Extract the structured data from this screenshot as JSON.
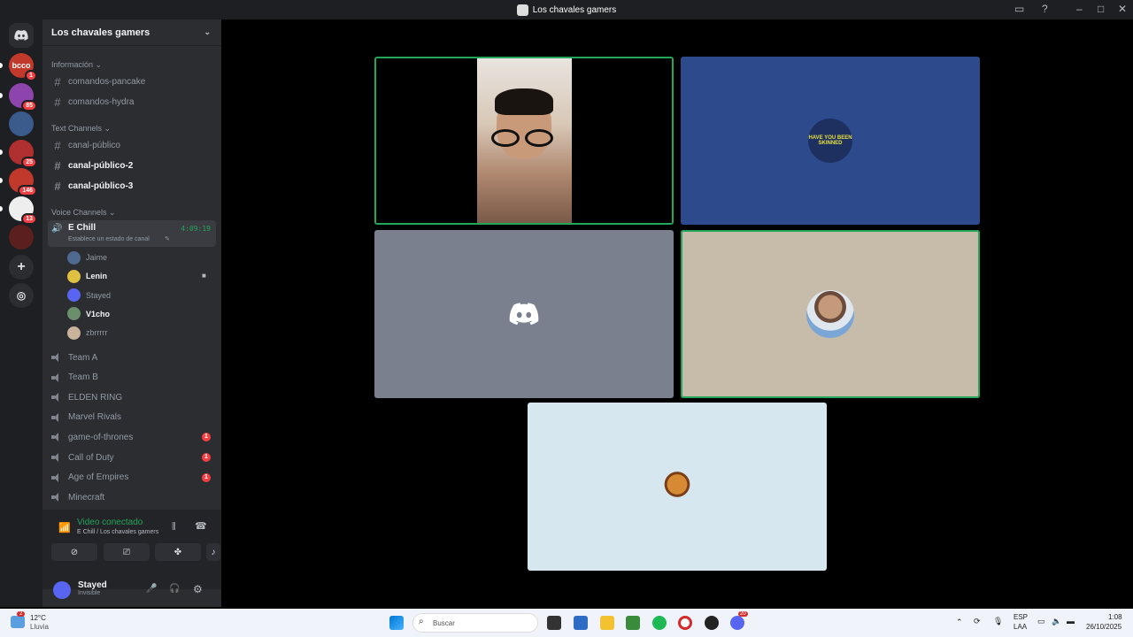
{
  "titlebar": {
    "title": "Los chavales gamers"
  },
  "rail": {
    "servers": [
      {
        "name": "bcco-server",
        "label": "bcco",
        "badge": "1",
        "color": "#c0392b"
      },
      {
        "name": "pancake-server",
        "label": "",
        "badge": "85",
        "color": "#8e44ad"
      },
      {
        "name": "hydra-server",
        "label": "",
        "badge": "",
        "color": "#3b5b8c"
      },
      {
        "name": "metal-server",
        "label": "",
        "badge": "25",
        "color": "#b03030"
      },
      {
        "name": "red-server",
        "label": "",
        "badge": "146",
        "color": "#c0392b"
      },
      {
        "name": "green-server",
        "label": "",
        "badge": "13",
        "color": "#eeeeee"
      },
      {
        "name": "skull-server",
        "label": "",
        "badge": "",
        "color": "#5c1f1f"
      }
    ]
  },
  "channels": {
    "guild_name": "Los chavales gamers",
    "cat_info": "Información",
    "info_channels": [
      "comandos-pancake",
      "comandos-hydra"
    ],
    "cat_text": "Text Channels",
    "text_channels": [
      "canal-público",
      "canal-público-2",
      "canal-público-3"
    ],
    "cat_voice": "Voice Channels",
    "active_voice": {
      "name": "E Chill",
      "timer": "4:09:19",
      "status": "Establece un estado de canal"
    },
    "users": [
      {
        "name": "Jaime",
        "color": "#4f6a8f"
      },
      {
        "name": "Lenin",
        "color": "#e0c040"
      },
      {
        "name": "Stayed",
        "color": "#5865f2"
      },
      {
        "name": "V1cho",
        "color": "#6a8f6a"
      },
      {
        "name": "zbrrrrr",
        "color": "#c9b39a"
      }
    ],
    "voice_channels": [
      {
        "name": "Team A",
        "badge": ""
      },
      {
        "name": "Team B",
        "badge": ""
      },
      {
        "name": "ELDEN RING",
        "badge": ""
      },
      {
        "name": "Marvel Rivals",
        "badge": ""
      },
      {
        "name": "game-of-thrones",
        "badge": "1"
      },
      {
        "name": "Call of Duty",
        "badge": "1"
      },
      {
        "name": "Age of Empires",
        "badge": "1"
      },
      {
        "name": "Minecraft",
        "badge": ""
      }
    ]
  },
  "voice_status": {
    "title": "Video conectado",
    "sub": "E Chill / Los chavales gamers"
  },
  "user_panel": {
    "name": "Stayed",
    "status": "Invisible"
  },
  "stage": {
    "tile_badge_text": "HAVE YOU BEEN SKINNED"
  },
  "taskbar": {
    "weather_temp": "12°C",
    "weather_desc": "Lluvia",
    "weather_badge": "2",
    "search_placeholder": "Buscar",
    "lang1": "ESP",
    "lang2": "LAA",
    "time": "1:08",
    "date": "26/10/2025",
    "discord_badge": "20"
  }
}
